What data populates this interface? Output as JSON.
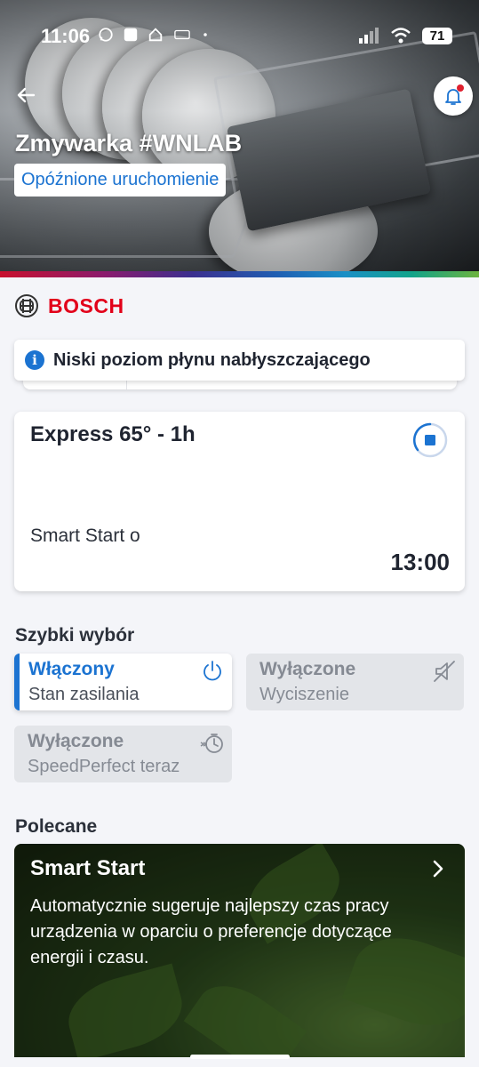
{
  "status_bar": {
    "time": "11:06",
    "battery": "71",
    "icons": [
      "whatsapp-icon",
      "app-square-icon",
      "home-icon",
      "badge-icon",
      "dot-icon",
      "signal-icon",
      "wifi-icon"
    ]
  },
  "header": {
    "title": "Zmywarka #WNLAB",
    "status_chip": "Opóźnione uruchomienie"
  },
  "brand": {
    "name": "BOSCH",
    "color": "#e2001a"
  },
  "notification": {
    "text": "Niski poziom płynu nabłyszczającego"
  },
  "program": {
    "name": "Express 65° - 1h",
    "subtitle": "Smart Start o",
    "time": "13:00"
  },
  "quick_select": {
    "title": "Szybki wybór",
    "tiles": [
      {
        "state": "Włączony",
        "label": "Stan zasilania",
        "active": true,
        "icon": "power-icon"
      },
      {
        "state": "Wyłączone",
        "label": "Wyciszenie",
        "active": false,
        "icon": "mute-icon"
      },
      {
        "state": "Wyłączone",
        "label": "SpeedPerfect teraz",
        "active": false,
        "icon": "speed-timer-icon"
      }
    ]
  },
  "recommended": {
    "title": "Polecane",
    "card_title": "Smart Start",
    "card_description": "Automatycznie sugeruje najlepszy czas pracy urządzenia w oparciu o preferencje dotyczące energii i czasu."
  },
  "colors": {
    "accent": "#1b73d1",
    "background": "#f4f5f9"
  }
}
